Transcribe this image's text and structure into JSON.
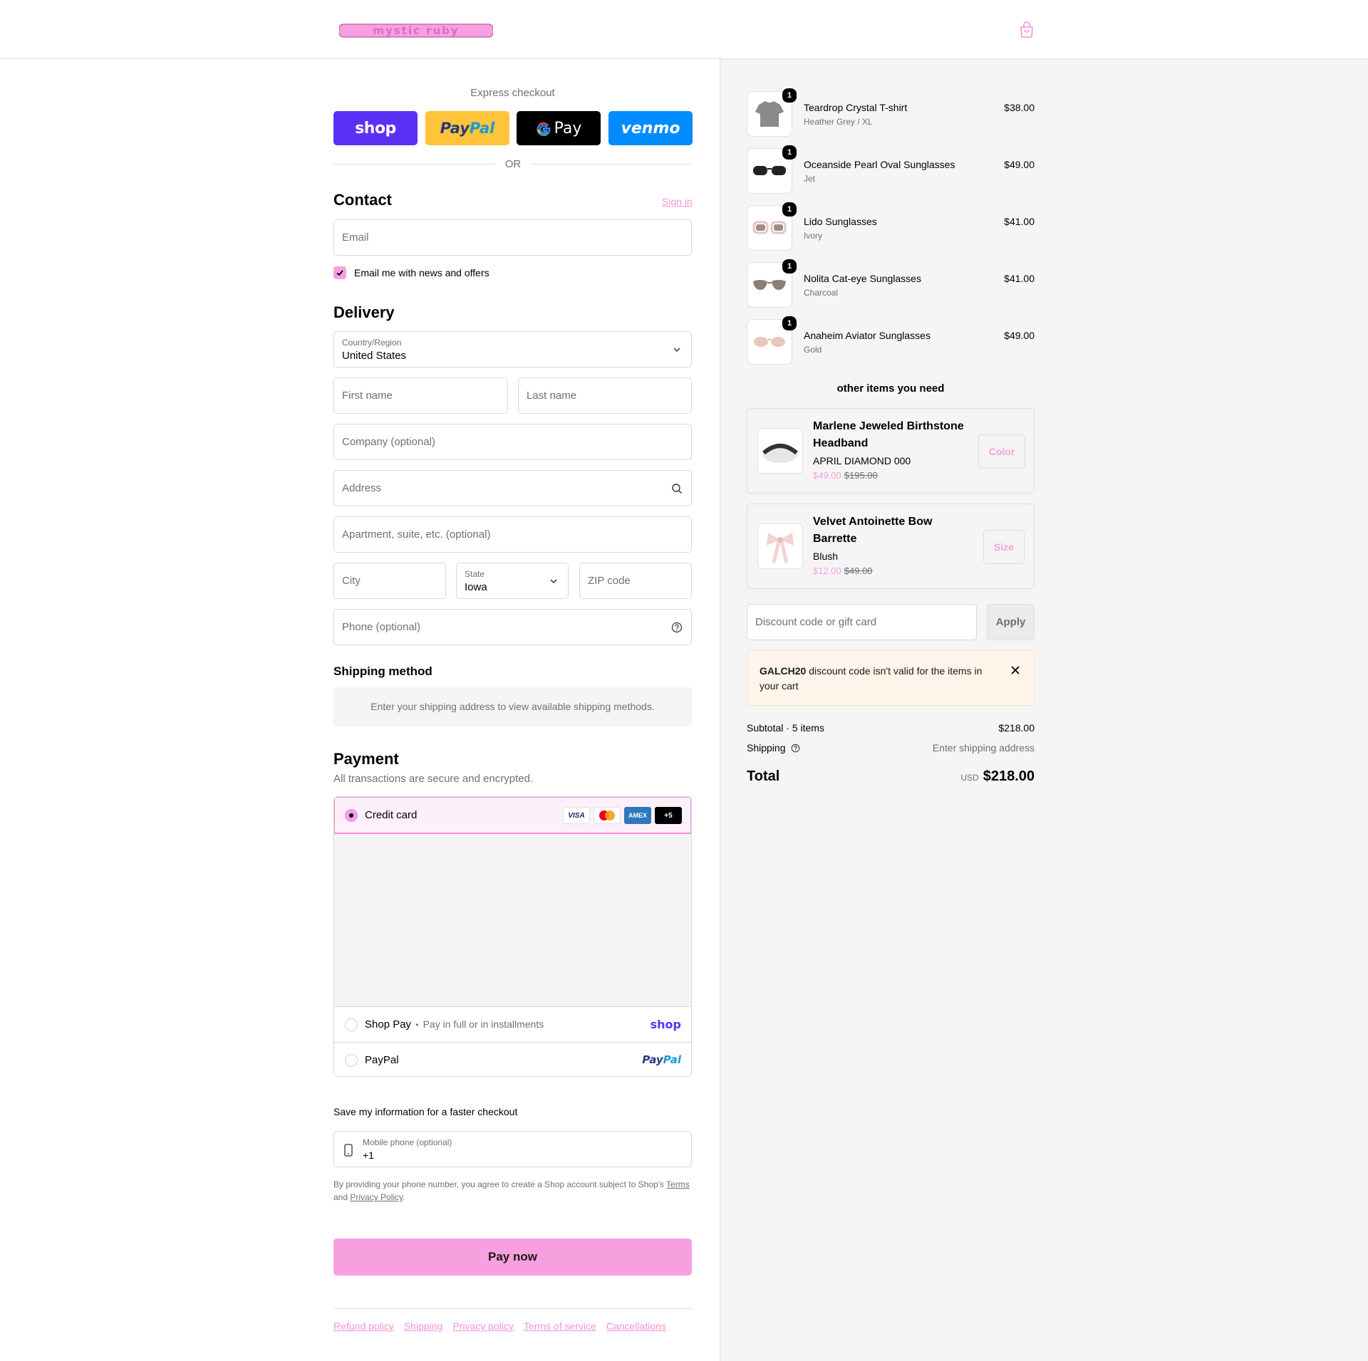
{
  "header": {
    "logo_text": "mystic ruby"
  },
  "express": {
    "label": "Express checkout",
    "shop": "shop",
    "paypal_a": "Pay",
    "paypal_b": "Pal",
    "gpay": "Pay",
    "venmo": "venmo",
    "or": "OR"
  },
  "contact": {
    "title": "Contact",
    "sign_in": "Sign in",
    "email_placeholder": "Email",
    "news_label": "Email me with news and offers"
  },
  "delivery": {
    "title": "Delivery",
    "country_label": "Country/Region",
    "country_value": "United States",
    "first_name": "First name",
    "last_name": "Last name",
    "company": "Company (optional)",
    "address": "Address",
    "apartment": "Apartment, suite, etc. (optional)",
    "city": "City",
    "state_label": "State",
    "state_value": "Iowa",
    "zip": "ZIP code",
    "phone": "Phone (optional)"
  },
  "shipping": {
    "title": "Shipping method",
    "message": "Enter your shipping address to view available shipping methods."
  },
  "payment": {
    "title": "Payment",
    "subtitle": "All transactions are secure and encrypted.",
    "credit_card": "Credit card",
    "badges": [
      "VISA",
      "",
      "AMEX",
      "+5"
    ],
    "shop_pay": "Shop Pay",
    "shop_pay_sep": "•",
    "shop_pay_desc": "Pay in full or in installments",
    "shop_logo": "shop",
    "paypal": "PayPal",
    "paypal_logo_a": "Pay",
    "paypal_logo_b": "Pal"
  },
  "save_info": {
    "title": "Save my information for a faster checkout",
    "mobile_label": "Mobile phone (optional)",
    "mobile_value": "+1",
    "legal_1": "By providing your phone number, you agree to create a Shop account subject to Shop's ",
    "terms": "Terms",
    "legal_2": " and ",
    "privacy": "Privacy Policy",
    "legal_3": "."
  },
  "pay_now": "Pay now",
  "footer": [
    "Refund policy",
    "Shipping",
    "Privacy policy",
    "Terms of service",
    "Cancellations"
  ],
  "cart": {
    "items": [
      {
        "name": "Teardrop Crystal T-shirt",
        "variant": "Heather Grey / XL",
        "price": "$38.00",
        "qty": "1"
      },
      {
        "name": "Oceanside Pearl Oval Sunglasses",
        "variant": "Jet",
        "price": "$49.00",
        "qty": "1"
      },
      {
        "name": "Lido Sunglasses",
        "variant": "Ivory",
        "price": "$41.00",
        "qty": "1"
      },
      {
        "name": "Nolita Cat-eye Sunglasses",
        "variant": "Charcoal",
        "price": "$41.00",
        "qty": "1"
      },
      {
        "name": "Anaheim Aviator Sunglasses",
        "variant": "Gold",
        "price": "$49.00",
        "qty": "1"
      }
    ],
    "upsell_title": "other items you need",
    "upsells": [
      {
        "name_1": "Marlene Jeweled Birthstone",
        "name_2": "Headband",
        "variant": "APRIL DIAMOND 000",
        "sale": "$49.00",
        "orig": "$195.00",
        "button": "Color"
      },
      {
        "name_1": "Velvet Antoinette Bow",
        "name_2": "Barrette",
        "variant": "Blush",
        "sale": "$12.00",
        "orig": "$49.00",
        "button": "Size"
      }
    ],
    "discount_placeholder": "Discount code or gift card",
    "apply": "Apply",
    "warning_code": "GALCH20",
    "warning_text": " discount code isn't valid for the items in your cart",
    "subtotal_label": "Subtotal · 5 items",
    "subtotal_value": "$218.00",
    "shipping_label": "Shipping",
    "shipping_value": "Enter shipping address",
    "total_label": "Total",
    "total_currency": "USD",
    "total_value": "$218.00"
  },
  "colors": {
    "accent": "#f7a0e0",
    "accent_text": "#f291d8",
    "shop": "#5a31f4",
    "paypal": "#ffc439",
    "venmo": "#008cff"
  }
}
